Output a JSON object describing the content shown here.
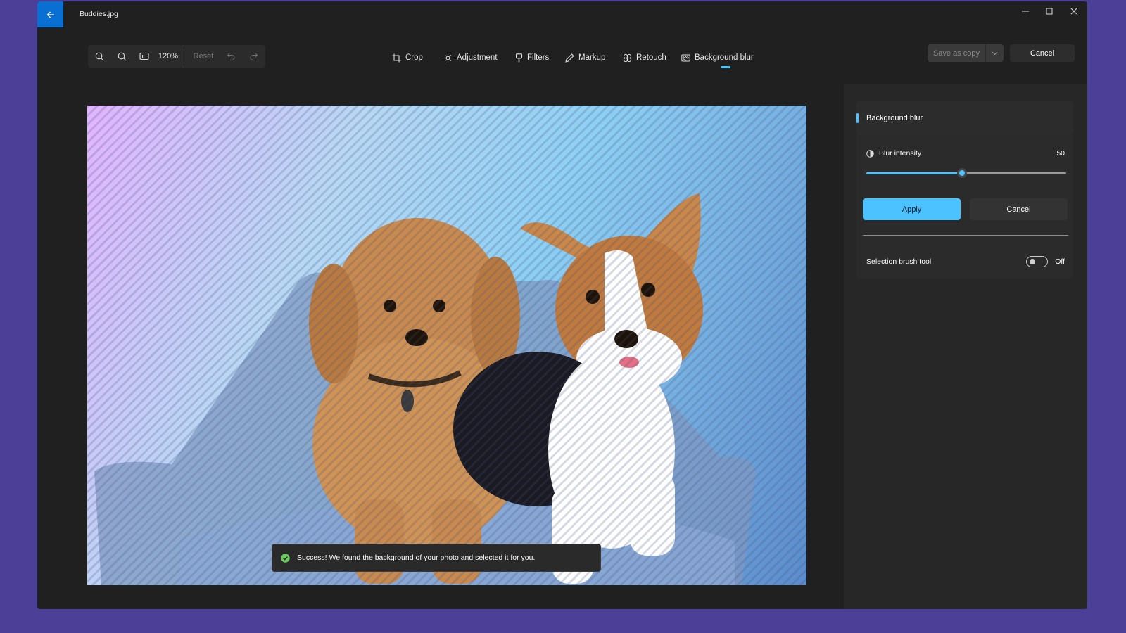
{
  "window": {
    "file_name": "Buddies.jpg"
  },
  "toolbar": {
    "zoom_level": "120%",
    "reset_label": "Reset"
  },
  "tools": [
    {
      "label": "Crop",
      "icon": "crop-icon"
    },
    {
      "label": "Adjustment",
      "icon": "brightness-icon"
    },
    {
      "label": "Filters",
      "icon": "filter-brush-icon"
    },
    {
      "label": "Markup",
      "icon": "pen-icon"
    },
    {
      "label": "Retouch",
      "icon": "retouch-icon"
    },
    {
      "label": "Background blur",
      "icon": "background-blur-icon",
      "active": true
    }
  ],
  "actions": {
    "save_as_copy": "Save as copy",
    "cancel": "Cancel"
  },
  "toast": {
    "message": "Success! We found the background of your photo and selected it for you.",
    "icon": "check-circle-icon"
  },
  "panel": {
    "header": "Background blur",
    "blur_label": "Blur intensity",
    "blur_value": "50",
    "blur_fraction": 0.48,
    "apply_label": "Apply",
    "cancel_label": "Cancel",
    "brush_label": "Selection brush tool",
    "brush_state": "Off"
  },
  "colors": {
    "accent": "#4cc2ff",
    "title_back": "#0a6fd3",
    "desktop": "#4b3f98",
    "window": "#202020"
  }
}
